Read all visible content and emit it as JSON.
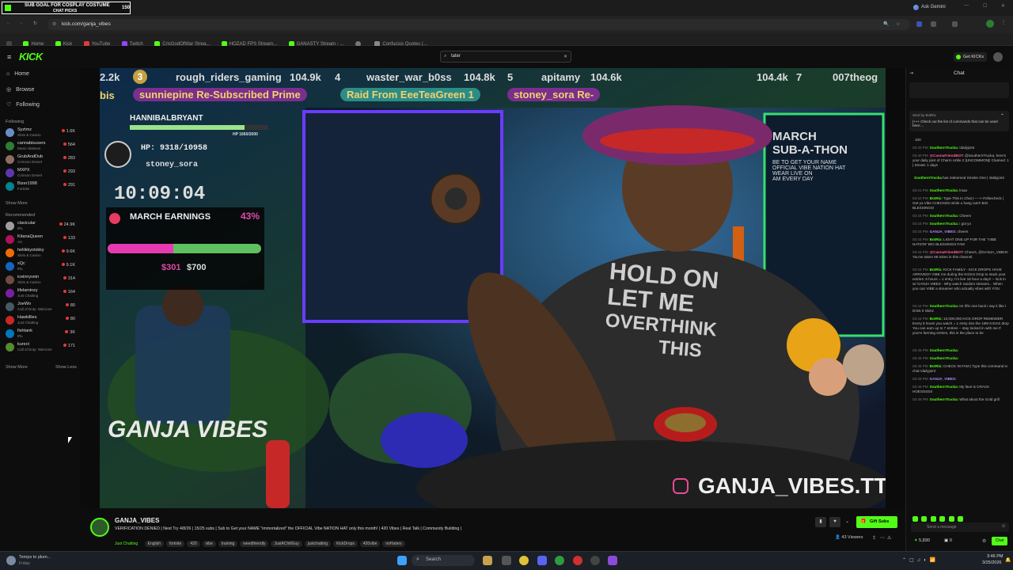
{
  "sub_goal": {
    "title": "SUB GOAL FOR COSPLAY COSTUME",
    "subtitle": "CHAT PICKS",
    "count": "150"
  },
  "browser": {
    "url": "kick.com/ganja_vibes",
    "ask_gemini": "Ask Gemini",
    "bookmarks": [
      "Home",
      "Kick",
      "YouTube",
      "Twitch",
      "CrisGodOfWar Strea...",
      "HOZAD FPS Stream...",
      "GANASTY Stream - ...",
      "",
      "Confucius Quotes (..."
    ]
  },
  "header": {
    "search_value": "tater",
    "get_kicks": "Get KICKs"
  },
  "sidebar": {
    "nav": [
      "Home",
      "Browse",
      "Following"
    ],
    "following_label": "Following",
    "following": [
      {
        "name": "Syztmz",
        "game": "Slots & Casino",
        "viewers": "1.6K",
        "color": "#6a8cc7"
      },
      {
        "name": "cannabisusers",
        "game": "Music Stations",
        "viewers": "564",
        "color": "#2e7d32"
      },
      {
        "name": "GrubAndDub",
        "game": "Crimson Desert",
        "viewers": "283",
        "color": "#8d6e63"
      },
      {
        "name": "MXPX",
        "game": "Crimson Desert",
        "viewers": "293",
        "color": "#5e35b1"
      },
      {
        "name": "Bizer1998",
        "game": "Fortnite",
        "viewers": "291",
        "color": "#00838f"
      }
    ],
    "show_more_1": "Show More",
    "recommended_label": "Recommended",
    "recommended": [
      {
        "name": "clavicular",
        "game": "IRL",
        "viewers": "24.9K",
        "color": "#9e9e9e"
      },
      {
        "name": "KitanaQueen",
        "game": "Art",
        "viewers": "133",
        "color": "#ad1457"
      },
      {
        "name": "heliikkyotskky",
        "game": "Slots & Casino",
        "viewers": "9.6K",
        "color": "#ef6c00"
      },
      {
        "name": "xQc",
        "game": "IRL",
        "viewers": "9.1K",
        "color": "#1565c0"
      },
      {
        "name": "iceinnyvein",
        "game": "Slots & Casino",
        "viewers": "314",
        "color": "#6d4c41"
      },
      {
        "name": "lifelaminzy",
        "game": "Just Chatting",
        "viewers": "164",
        "color": "#7b1fa2"
      },
      {
        "name": "JoeWo",
        "game": "Call of Duty: Warzone",
        "viewers": "80",
        "color": "#455a64"
      },
      {
        "name": "Hawkillies",
        "game": "Just Chatting",
        "viewers": "80",
        "color": "#c62828"
      },
      {
        "name": "fishtank",
        "game": "IRL",
        "viewers": "3K",
        "color": "#0277bd"
      },
      {
        "name": "kurect",
        "game": "Call of Duty: Warzone",
        "viewers": "171",
        "color": "#558b2f"
      }
    ],
    "show_more_2": "Show More",
    "show_less": "Show Less"
  },
  "video": {
    "leaderboard": [
      {
        "rank": "",
        "name": "",
        "value": "2.2k"
      },
      {
        "rank": "3",
        "name": "rough_riders_gaming",
        "value": "104.9k"
      },
      {
        "rank": "4",
        "name": "waster_war_b0ss",
        "value": "104.8k"
      },
      {
        "rank": "5",
        "name": "apitamy",
        "value": "104.6k"
      },
      {
        "rank": "",
        "name": "",
        "value": "104.4k"
      },
      {
        "rank": "7",
        "name": "007theog",
        "value": ""
      }
    ],
    "ticker": [
      "bis",
      "sunniepine Re-Subscribed Prime",
      "Raid From EeeTeaGreen 1",
      "stoney_sora Re-"
    ],
    "boss": {
      "name": "HANNIBALBRYANT",
      "hp_small": "HP 1660/2000",
      "hp": "HP: 9318/10958",
      "user": "stoney_sora"
    },
    "timer": "10:09:04",
    "earnings_label": "MARCH EARNINGS",
    "earnings_pct": "43%",
    "earnings_current": "$301",
    "earnings_goal": "$700",
    "earnings_progress": 0.43,
    "subathon": [
      "MARCH",
      "SUB-A-THON",
      "BE TO GET YOUR NAME",
      "OFFICIAL VIBE NATION HAT",
      "WEAR LIVE ON",
      "AM EVERY DAY"
    ],
    "logo_text": "GANJA VIBES",
    "handle": "GANJA_VIBES.TTV",
    "shirt": [
      "HOLD ON",
      "LET ME",
      "OVERTHINK",
      "THIS"
    ]
  },
  "stream_info": {
    "channel": "GANJA_VIBES",
    "title": "VERIFICATION DENIED | Next Try 4/8/26 | 15/25 subs | Sub to Get your NAME \"immortalized\" the OFFICIAL Vibe NATION HAT only this month! | 420 Vibes | Real Talk | Community Building |",
    "category": "Just Chatting",
    "tags": [
      "English",
      "fortnite",
      "420",
      "vibe",
      "training",
      "weedfriendly",
      "JustAChillGuy",
      "justchatting",
      "KickDrops",
      "420vibe",
      "noHaters"
    ],
    "gift_subs": "Gift Subs",
    "viewers": "43 Viewers"
  },
  "chat": {
    "title": "Chat",
    "pinned": "Sent by BotRix",
    "pinned_text": "|+++ Check out the list of commands that can be used here:...",
    "messages": [
      {
        "time": "",
        "user": "",
        "color": "#bbb",
        "text": "100"
      },
      {
        "time": "03:40 PM",
        "user": "SouthernTrucka:",
        "color": "#53fc18",
        "text": "!dailyjoint"
      },
      {
        "time": "03:40 PM",
        "user": "@CannaFriendBOT:",
        "color": "#ff5ea0",
        "text": "@SouthernTrucka, here's your daily joint of Charm Urkle 2 [UNCOMMON]! Claimed: 1 | Streak: 1 days"
      },
      {
        "time": "",
        "user": "SouthernTrucka",
        "color": "#53fc18",
        "text": "has redeemed Smoke One | !dailyjoint"
      },
      {
        "time": "03:41 PM",
        "user": "SouthernTrucka:",
        "color": "#53fc18",
        "text": "lmao"
      },
      {
        "time": "03:42 PM",
        "user": "BotRix:",
        "color": "#53fc18",
        "text": "Type This In Chat |-----> #Vibecheck | Get ya Vibe CHECKED while u hang out!!! BIG BLESSINGS!"
      },
      {
        "time": "03:44 PM",
        "user": "SouthernTrucka:",
        "color": "#53fc18",
        "text": "Cheers"
      },
      {
        "time": "03:44 PM",
        "user": "SouthernTrucka:",
        "color": "#53fc18",
        "text": "i got yo"
      },
      {
        "time": "03:44 PM",
        "user": "GANJA_VIBES:",
        "color": "#b388ff",
        "text": "cheers"
      },
      {
        "time": "03:44 PM",
        "user": "BotRix:",
        "color": "#53fc18",
        "text": "LIGHT ONE UP FOR THE \"VIBE NATION\" BIG BLESSINGS FAM"
      },
      {
        "time": "03:44 PM",
        "user": "@CannaFriendBOT:",
        "color": "#ff5ea0",
        "text": "Cheers, @GANJA_VIBES! You've taken 68 tokes in this channel."
      },
      {
        "time": "03:44 PM",
        "user": "BotRix:",
        "color": "#53fc18",
        "text": "KICK FAMILY - KICK DROPS HAVE ARRIVED!! VIBE me during the KICKS Drop to stack your entries: 5 hours = 1 entry, I'm live 18 hour a day!! -- lock in w/ GANJA VIBES - Why watch random streams... When you can VIBE a streamer who actually vibes with YOU"
      },
      {
        "time": "03:44 PM",
        "user": "SouthernTrucka:",
        "color": "#53fc18",
        "text": "Im lil'in one back I say it like I Drink it Skinz"
      },
      {
        "time": "03:44 PM",
        "user": "BotRix:",
        "color": "#53fc18",
        "text": "10,000,000 KICK DROP REMINDER Every 5 hours you watch = 1 entry into the 10M KICKS drop You can earn up to 7 entries -- stay locked in with me If you're farming entries, this is the place to be"
      },
      {
        "time": "03:45 PM",
        "user": "SouthernTrucka:",
        "color": "#53fc18",
        "text": ""
      },
      {
        "time": "03:45 PM",
        "user": "SouthernTrucka:",
        "color": "#53fc18",
        "text": ""
      },
      {
        "time": "03:46 PM",
        "user": "BotRix:",
        "color": "#53fc18",
        "text": "CHECK IN FAM | Type this command in chat !dailyjoint"
      },
      {
        "time": "03:46 PM",
        "user": "GANJA_VIBES:",
        "color": "#b388ff",
        "text": ""
      },
      {
        "time": "03:46 PM",
        "user": "SouthernTrucka:",
        "color": "#53fc18",
        "text": "My fave is CRACK HOESSSSS"
      },
      {
        "time": "03:46 PM",
        "user": "SouthernTrucka:",
        "color": "#53fc18",
        "text": "What about the Gold grill"
      }
    ],
    "placeholder": "Send a message",
    "points": "5,830",
    "kicks": "0",
    "chat_button": "Chat"
  },
  "taskbar": {
    "weather": "Temps to plum...",
    "weather_sub": "Friday",
    "search": "Search",
    "time": "3:46 PM",
    "date": "3/25/2026"
  }
}
